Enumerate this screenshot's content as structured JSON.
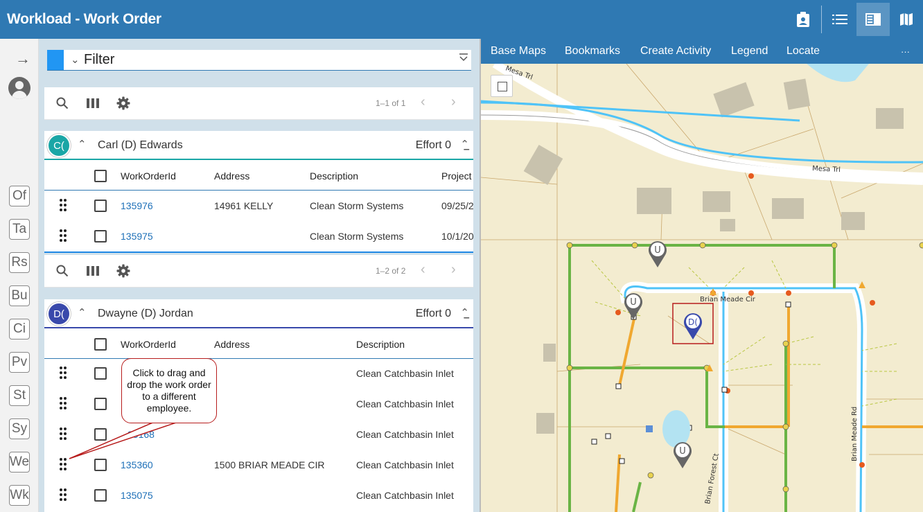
{
  "app": {
    "title": "Workload - Work Order"
  },
  "topbar": {
    "icons": [
      "clipboard-user-icon",
      "list-icon",
      "split-view-icon",
      "map-icon"
    ],
    "active": "split-view-icon"
  },
  "rail": {
    "arrow": "→",
    "tabs": [
      "Of",
      "Ta",
      "Rs",
      "Bu",
      "Ci",
      "Pv",
      "St",
      "Sy",
      "We",
      "Wk"
    ]
  },
  "filter": {
    "label": "Filter"
  },
  "groups": [
    {
      "initials": "C(",
      "name": "Carl (D) Edwards",
      "effort": "Effort 0",
      "accent": "#1aa6a6",
      "pager": "1–1 of 1",
      "columns": [
        "WorkOrderId",
        "Address",
        "Description",
        "Project"
      ],
      "rows": [
        {
          "id": "135976",
          "address": "14961 KELLY",
          "description": "Clean Storm Systems",
          "project": "09/25/2"
        },
        {
          "id": "135975",
          "address": "",
          "description": "Clean Storm Systems",
          "project": "10/1/20"
        }
      ]
    },
    {
      "initials": "D(",
      "name": "Dwayne (D) Jordan",
      "effort": "Effort 0",
      "accent": "#3949ab",
      "pager": "1–2 of 2",
      "columns": [
        "WorkOrderId",
        "Address",
        "Description"
      ],
      "rows": [
        {
          "id": "",
          "address": "",
          "description": "Clean Catchbasin Inlet"
        },
        {
          "id": "",
          "address": "",
          "description": "Clean Catchbasin Inlet"
        },
        {
          "id": "35168",
          "address": "",
          "description": "Clean Catchbasin Inlet"
        },
        {
          "id": "135360",
          "address": "1500 BRIAR MEADE CIR",
          "description": "Clean Catchbasin Inlet"
        },
        {
          "id": "135075",
          "address": "",
          "description": "Clean Catchbasin Inlet"
        }
      ]
    }
  ],
  "callout": {
    "text": "Click to drag and drop the work order to a different employee."
  },
  "map": {
    "toolbar": [
      "Base Maps",
      "Bookmarks",
      "Create Activity",
      "Legend",
      "Locate",
      "···"
    ],
    "labels": {
      "mesa_top": "Mesa Trl",
      "mesa": "Mesa Trl",
      "briar": "Brian Meade Cir",
      "forest": "Brian Forest Ct",
      "briar_rd": "Brian Meade Rd"
    },
    "markers": {
      "u1": "U",
      "u2": "U",
      "u3": "U",
      "d": "D("
    }
  }
}
